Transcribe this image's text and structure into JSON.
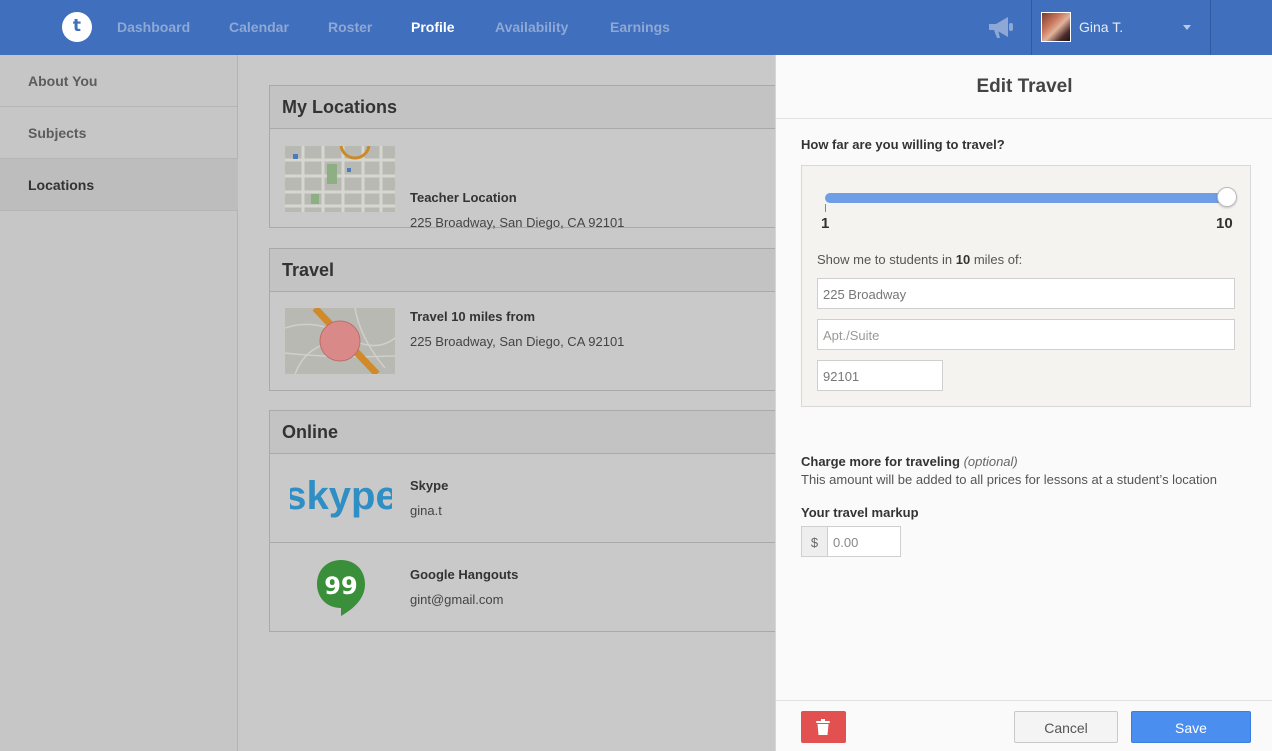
{
  "nav": {
    "logo_text": "t",
    "links": [
      {
        "label": "Dashboard"
      },
      {
        "label": "Calendar"
      },
      {
        "label": "Roster"
      },
      {
        "label": "Profile"
      },
      {
        "label": "Availability"
      },
      {
        "label": "Earnings"
      }
    ],
    "active_link": "Profile",
    "user_name": "Gina T.",
    "icons": [
      "megaphone-icon",
      "chevron-down-icon"
    ]
  },
  "sidebar": {
    "items": [
      {
        "label": "About You"
      },
      {
        "label": "Subjects"
      },
      {
        "label": "Locations"
      }
    ],
    "active_item": "Locations"
  },
  "main": {
    "my_locations": {
      "title": "My Locations",
      "items": [
        {
          "title": "Teacher Location",
          "address": "225 Broadway, San Diego, CA 92101"
        }
      ]
    },
    "travel": {
      "title": "Travel",
      "items": [
        {
          "title": "Travel 10 miles from",
          "address": "225 Broadway, San Diego, CA 92101"
        }
      ]
    },
    "online": {
      "title": "Online",
      "items": [
        {
          "title": "Skype",
          "value": "gina.t",
          "logo_text": "skype"
        },
        {
          "title": "Google Hangouts",
          "value": "gint@gmail.com",
          "logo_text": "99"
        }
      ]
    }
  },
  "drawer": {
    "title": "Edit Travel",
    "question": "How far are you willing to travel?",
    "slider": {
      "min": "1",
      "max": "10",
      "value": 10
    },
    "show_me_prefix": "Show me to students in ",
    "show_me_value": "10",
    "show_me_suffix": " miles of:",
    "address": {
      "value": "225 Broadway"
    },
    "apt": {
      "placeholder": "Apt./Suite"
    },
    "zip": {
      "value": "92101"
    },
    "charge_title": "Charge more for traveling",
    "charge_optional": "(optional)",
    "charge_desc": "This amount will be added to all prices for lessons at a student’s location",
    "markup_label": "Your travel markup",
    "currency_symbol": "$",
    "markup_placeholder": "0.00",
    "cancel_label": "Cancel",
    "save_label": "Save",
    "delete_icon": "trash-icon"
  },
  "colors": {
    "nav_bg": "#3f6fbd",
    "accent": "#4a8ef0",
    "danger": "#e25050",
    "slider": "#6e9ee6"
  }
}
